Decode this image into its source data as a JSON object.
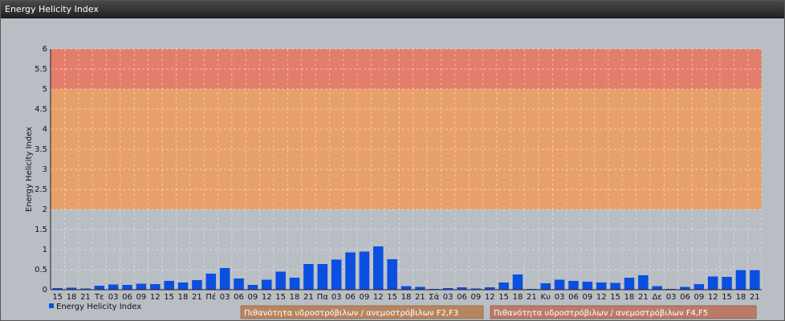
{
  "window": {
    "title": "Energy Helicity Index"
  },
  "chart_data": {
    "type": "bar",
    "ylabel": "Energy Helicity Index",
    "ylim": [
      0,
      6
    ],
    "yticks": [
      "0",
      "0.5",
      "1",
      "1.5",
      "2",
      "2.5",
      "3",
      "3.5",
      "4",
      "4.5",
      "5",
      "5.5",
      "6"
    ],
    "categories": [
      "15",
      "18",
      "21",
      "Τε",
      "03",
      "06",
      "09",
      "12",
      "15",
      "18",
      "21",
      "Πέ",
      "03",
      "06",
      "09",
      "12",
      "15",
      "18",
      "21",
      "Πα",
      "03",
      "06",
      "09",
      "12",
      "15",
      "18",
      "21",
      "Σά",
      "03",
      "06",
      "09",
      "12",
      "15",
      "18",
      "21",
      "Κυ",
      "03",
      "06",
      "09",
      "12",
      "15",
      "18",
      "21",
      "Δε",
      "03",
      "06",
      "09",
      "12",
      "15",
      "18",
      "21"
    ],
    "series": [
      {
        "name": "Energy Helicity Index",
        "color": "#0a4fe0",
        "values": [
          0.04,
          0.05,
          0.03,
          0.1,
          0.13,
          0.12,
          0.15,
          0.14,
          0.22,
          0.18,
          0.24,
          0.4,
          0.54,
          0.28,
          0.12,
          0.25,
          0.45,
          0.3,
          0.64,
          0.64,
          0.75,
          0.93,
          0.95,
          1.08,
          0.76,
          0.09,
          0.07,
          0.02,
          0.04,
          0.06,
          0.03,
          0.06,
          0.18,
          0.38,
          0.02,
          0.16,
          0.25,
          0.22,
          0.2,
          0.18,
          0.17,
          0.3,
          0.36,
          0.09,
          0.02,
          0.07,
          0.14,
          0.33,
          0.32,
          0.49,
          0.49
        ]
      }
    ],
    "bands": [
      {
        "from": 2,
        "to": 5,
        "color": "#e8a06a",
        "label": "Πιθανότητα υδροστρόβιλων / ανεμοστρόβιλων F2,F3",
        "legend_color": "#b8845e"
      },
      {
        "from": 5,
        "to": 6,
        "color": "#e47e6c",
        "label": "Πιθανότητα υδροστρόβιλων / ανεμοστρόβιλων F4,F5",
        "legend_color": "#bb7b68"
      }
    ],
    "grid": true,
    "legend": "bottom"
  }
}
